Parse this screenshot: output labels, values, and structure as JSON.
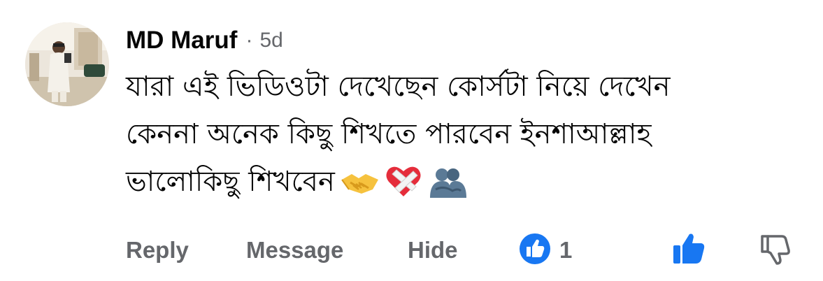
{
  "comment": {
    "author": "MD Maruf",
    "separator": "·",
    "time": "5d",
    "lines": [
      "যারা এই ভিডিওটা দেখেছেন কোর্সটা নিয়ে দেখেন",
      "কেননা অনেক কিছু শিখতে পারবেন ইনশাআল্লাহ",
      "ভালোকিছু শিখবেন"
    ],
    "emojis": [
      "handshake-emoji",
      "mending-heart-emoji",
      "people-hugging-emoji"
    ]
  },
  "actions": {
    "reply": "Reply",
    "message": "Message",
    "hide": "Hide",
    "reaction_count": "1"
  },
  "colors": {
    "text": "#050505",
    "secondary": "#65676b",
    "like_blue": "#1877f2"
  }
}
